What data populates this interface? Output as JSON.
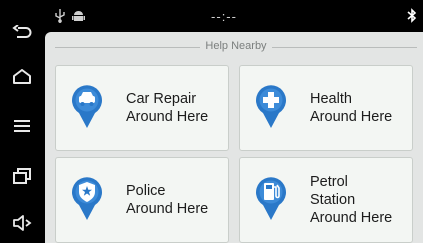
{
  "status_bar": {
    "clock": "--:--",
    "usb_icon": "usb-icon",
    "android_icon": "android-icon",
    "bluetooth_icon": "bluetooth-icon"
  },
  "nav_bar": {
    "items": [
      {
        "icon": "back-icon"
      },
      {
        "icon": "home-icon"
      },
      {
        "icon": "menu-icon"
      },
      {
        "icon": "recent-apps-icon"
      },
      {
        "icon": "volume-icon"
      }
    ]
  },
  "section": {
    "title": "Help Nearby"
  },
  "tiles": [
    {
      "label": "Car Repair\nAround Here",
      "icon": "car-repair-icon"
    },
    {
      "label": "Health\nAround Here",
      "icon": "health-icon"
    },
    {
      "label": "Police\nAround Here",
      "icon": "police-icon"
    },
    {
      "label": "Petrol\nStation\nAround Here",
      "icon": "petrol-station-icon"
    }
  ],
  "colors": {
    "pin_blue": "#2a78c8",
    "background": "#e3e5e4",
    "tile": "#f3f6f3"
  }
}
